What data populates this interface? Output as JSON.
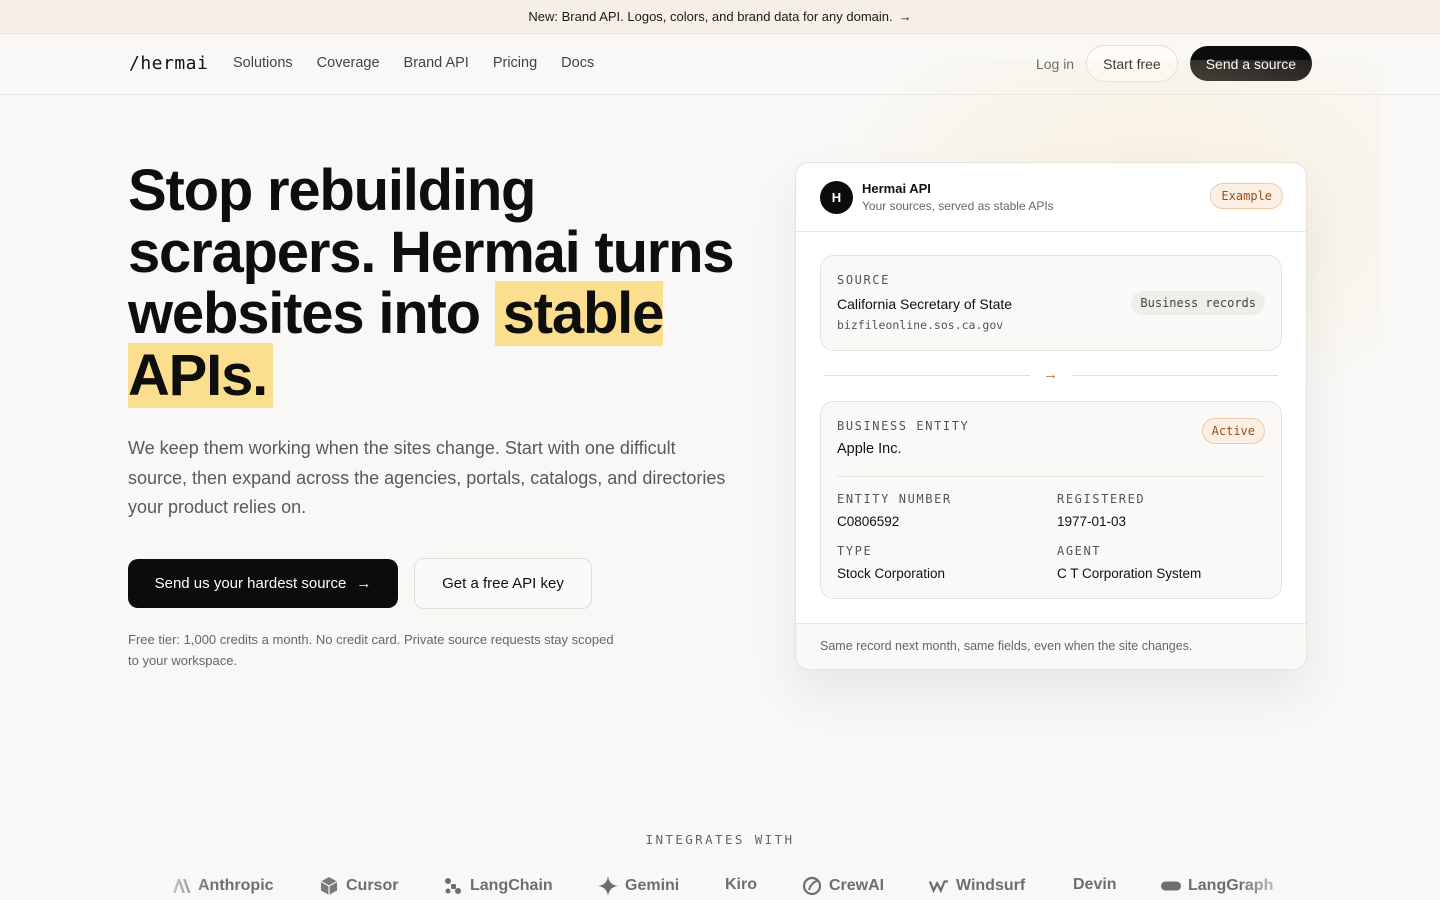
{
  "announcement": {
    "text": "New: Brand API. Logos, colors, and brand data for any domain.",
    "arrow": "→"
  },
  "nav": {
    "logo": "/hermai",
    "links": [
      "Solutions",
      "Coverage",
      "Brand API",
      "Pricing",
      "Docs"
    ],
    "login": "Log in",
    "start_free": "Start free",
    "send_source": "Send a source"
  },
  "hero": {
    "title_main": "Stop rebuilding scrapers. Hermai turns websites into ",
    "title_highlight": "stable APIs.",
    "subtitle": "We keep them working when the sites change. Start with one difficult source, then expand across the agencies, portals, catalogs, and directories your product relies on.",
    "cta_primary": "Send us your hardest source",
    "cta_primary_arrow": "→",
    "cta_secondary": "Get a free API key",
    "note": "Free tier: 1,000 credits a month. No credit card. Private source requests stay scoped to your workspace."
  },
  "card": {
    "avatar": "H",
    "title": "Hermai API",
    "subtitle": "Your sources, served as stable APIs",
    "badge": "Example",
    "source": {
      "label": "SOURCE",
      "name": "California Secretary of State",
      "url": "bizfileonline.sos.ca.gov",
      "tag": "Business records"
    },
    "flow_arrow": "→",
    "entity": {
      "label": "BUSINESS ENTITY",
      "name": "Apple Inc.",
      "status": "Active",
      "fields": [
        {
          "label": "ENTITY NUMBER",
          "value": "C0806592"
        },
        {
          "label": "REGISTERED",
          "value": "1977-01-03"
        },
        {
          "label": "TYPE",
          "value": "Stock Corporation"
        },
        {
          "label": "AGENT",
          "value": "C T Corporation System"
        }
      ]
    },
    "footer": "Same record next month, same fields, even when the site changes."
  },
  "integrations": {
    "label": "INTEGRATES WITH",
    "items": [
      {
        "name": "Anthropic",
        "icon": "anthropic-icon"
      },
      {
        "name": "Cursor",
        "icon": "cursor-icon"
      },
      {
        "name": "LangChain",
        "icon": "langchain-icon"
      },
      {
        "name": "Gemini",
        "icon": "gemini-icon"
      },
      {
        "name": "Kiro",
        "icon": ""
      },
      {
        "name": "CrewAI",
        "icon": "crewai-icon"
      },
      {
        "name": "Windsurf",
        "icon": "windsurf-icon"
      },
      {
        "name": "Devin",
        "icon": ""
      },
      {
        "name": "LangGraph",
        "icon": "langgraph-icon"
      }
    ]
  },
  "colors": {
    "accent": "#fbdf8e",
    "badge_bg": "#fbefe4",
    "badge_text": "#9a4e1c",
    "dark": "#0c0c0c"
  }
}
